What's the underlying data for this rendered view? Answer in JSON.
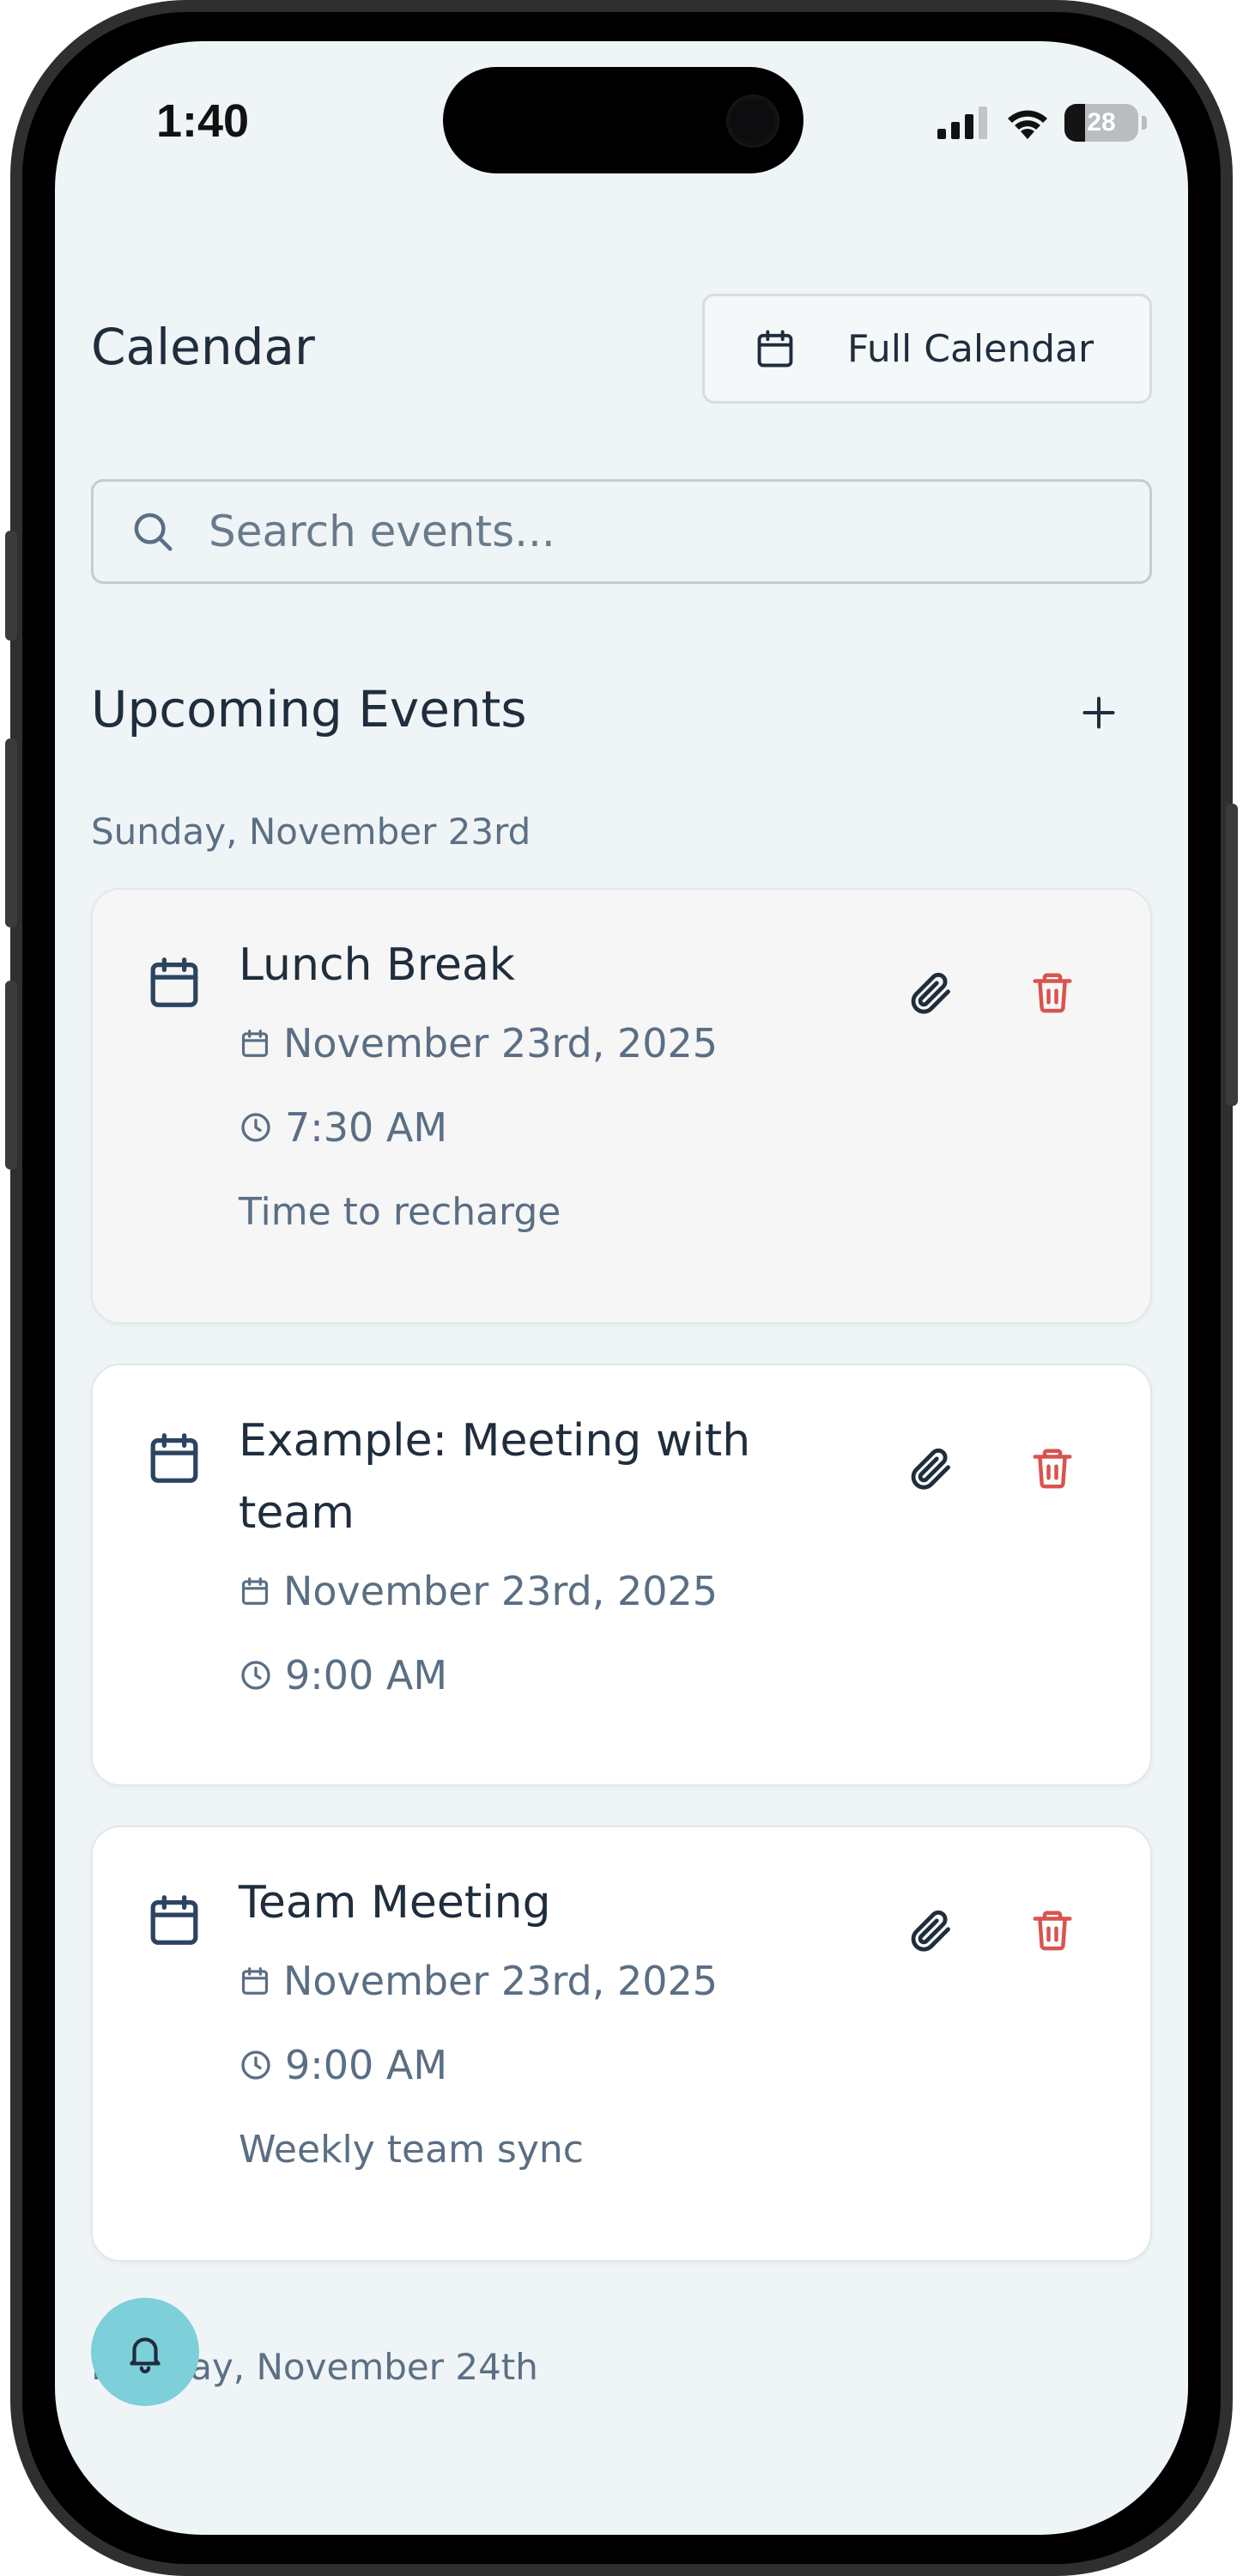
{
  "status_bar": {
    "time": "1:40",
    "battery_level": "28",
    "battery_fraction": 0.28
  },
  "header": {
    "title": "Calendar",
    "full_calendar_label": "Full Calendar",
    "full_calendar_icon": "calendar-icon"
  },
  "search": {
    "placeholder": "Search events...",
    "value": "",
    "icon": "search-icon"
  },
  "upcoming": {
    "title": "Upcoming Events",
    "add_icon": "plus-icon"
  },
  "groups": [
    {
      "date_label": "Sunday, November 23rd",
      "events": [
        {
          "title": "Lunch Break",
          "date": "November 23rd, 2025",
          "time": "7:30 AM",
          "description": "Time to recharge"
        },
        {
          "title": "Example: Meeting with team",
          "date": "November 23rd, 2025",
          "time": "9:00 AM",
          "description": ""
        },
        {
          "title": "Team Meeting",
          "date": "November 23rd, 2025",
          "time": "9:00 AM",
          "description": "Weekly team sync"
        }
      ]
    },
    {
      "date_label": "Monday, November 24th",
      "events": []
    }
  ],
  "colors": {
    "background": "#eff5f7",
    "text_primary": "#1f2d3d",
    "text_secondary": "#5a6e84",
    "delete_red": "#d9534f",
    "fab": "#7dcfd9"
  },
  "fab": {
    "icon": "bell-icon"
  }
}
